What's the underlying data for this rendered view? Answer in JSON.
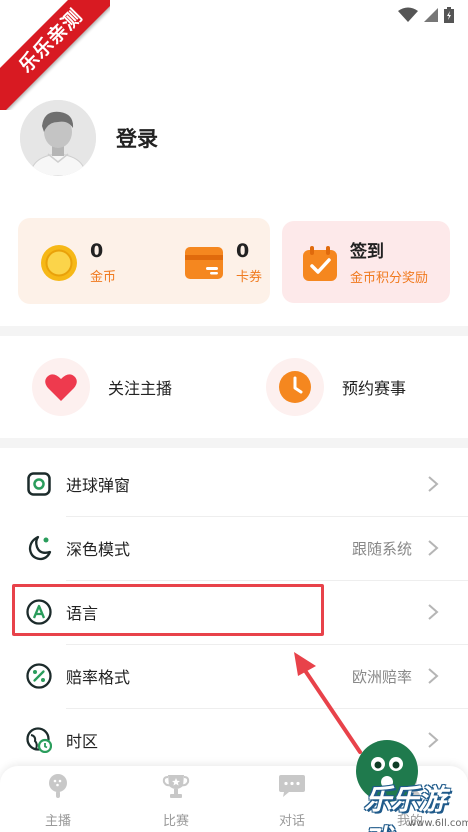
{
  "watermark": {
    "ribbon_text": "乐乐亲测",
    "site_text": "乐乐游戏",
    "site_url": "www.6ll.com"
  },
  "profile": {
    "login_label": "登录"
  },
  "wallet": {
    "coins": {
      "value": "0",
      "label": "金币"
    },
    "coupons": {
      "value": "0",
      "label": "卡券"
    }
  },
  "signin": {
    "title": "签到",
    "subtitle": "金币积分奖励"
  },
  "quick_actions": [
    {
      "label": "关注主播",
      "icon": "heart-icon"
    },
    {
      "label": "预约赛事",
      "icon": "clock-icon"
    }
  ],
  "menu": [
    {
      "label": "进球弹窗",
      "value": "",
      "icon": "goal-popup-icon"
    },
    {
      "label": "深色模式",
      "value": "跟随系统",
      "icon": "moon-icon"
    },
    {
      "label": "语言",
      "value": "",
      "icon": "language-icon"
    },
    {
      "label": "赔率格式",
      "value": "欧洲赔率",
      "icon": "percent-icon"
    },
    {
      "label": "时区",
      "value": "",
      "icon": "globe-clock-icon"
    }
  ],
  "bottom_nav": [
    {
      "label": "主播",
      "icon": "microphone-icon"
    },
    {
      "label": "比赛",
      "icon": "trophy-icon"
    },
    {
      "label": "对话",
      "icon": "chat-icon"
    },
    {
      "label": "我的",
      "icon": "user-icon"
    }
  ],
  "colors": {
    "accent_orange": "#f07a1f",
    "highlight_red": "#e8424a",
    "ribbon_red": "#d81a22"
  }
}
